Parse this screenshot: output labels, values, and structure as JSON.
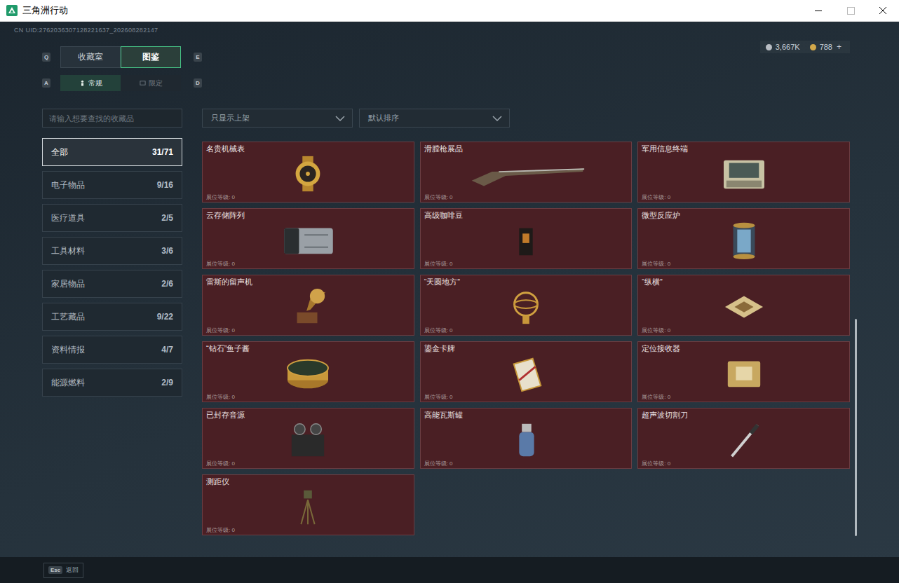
{
  "window": {
    "title": "三角洲行动"
  },
  "uid": "CN UID:2762036307128221637_202608282147",
  "currencies": [
    {
      "amount": "3,667K",
      "color": "#b9bec4"
    },
    {
      "amount": "788",
      "color": "#d2a84a"
    }
  ],
  "currency_add": "+",
  "tabs": {
    "prev_key": "Q",
    "next_key": "E",
    "items": [
      {
        "label": "收藏室",
        "selected": false
      },
      {
        "label": "图鉴",
        "selected": true
      }
    ]
  },
  "subtabs": {
    "prev_key": "A",
    "next_key": "D",
    "items": [
      {
        "label": "常规",
        "selected": true
      },
      {
        "label": "限定",
        "selected": false
      }
    ]
  },
  "search": {
    "placeholder": "请输入想要查找的收藏品"
  },
  "filters": [
    {
      "label": "只显示上架"
    },
    {
      "label": "默认排序"
    }
  ],
  "categories": [
    {
      "name": "全部",
      "count": "31/71",
      "selected": true
    },
    {
      "name": "电子物品",
      "count": "9/16",
      "selected": false
    },
    {
      "name": "医疗道具",
      "count": "2/5",
      "selected": false
    },
    {
      "name": "工具材料",
      "count": "3/6",
      "selected": false
    },
    {
      "name": "家居物品",
      "count": "2/6",
      "selected": false
    },
    {
      "name": "工艺藏品",
      "count": "9/22",
      "selected": false
    },
    {
      "name": "资料情报",
      "count": "4/7",
      "selected": false
    },
    {
      "name": "能源燃料",
      "count": "2/9",
      "selected": false
    }
  ],
  "items": [
    {
      "name": "名贵机械表",
      "level_label": "展位等级: 0"
    },
    {
      "name": "滑膛枪展品",
      "level_label": "展位等级: 0"
    },
    {
      "name": "军用信息终端",
      "level_label": "展位等级: 0"
    },
    {
      "name": "云存储阵列",
      "level_label": "展位等级: 0"
    },
    {
      "name": "高级咖啡豆",
      "level_label": "展位等级: 0"
    },
    {
      "name": "微型反应炉",
      "level_label": "展位等级: 0"
    },
    {
      "name": "雷斯的留声机",
      "level_label": "展位等级: 0"
    },
    {
      "name": "“天圆地方”",
      "level_label": "展位等级: 0"
    },
    {
      "name": "“纵横”",
      "level_label": "展位等级: 0"
    },
    {
      "name": "“钻石”鱼子酱",
      "level_label": "展位等级: 0"
    },
    {
      "name": "鎏金卡牌",
      "level_label": "展位等级: 0"
    },
    {
      "name": "定位接收器",
      "level_label": "展位等级: 0"
    },
    {
      "name": "已封存音源",
      "level_label": "展位等级: 0"
    },
    {
      "name": "高能瓦斯罐",
      "level_label": "展位等级: 0"
    },
    {
      "name": "超声波切割刀",
      "level_label": "展位等级: 0"
    },
    {
      "name": "测距仪",
      "level_label": "展位等级: 0"
    }
  ],
  "footer": {
    "key": "Esc",
    "label": "返回"
  }
}
